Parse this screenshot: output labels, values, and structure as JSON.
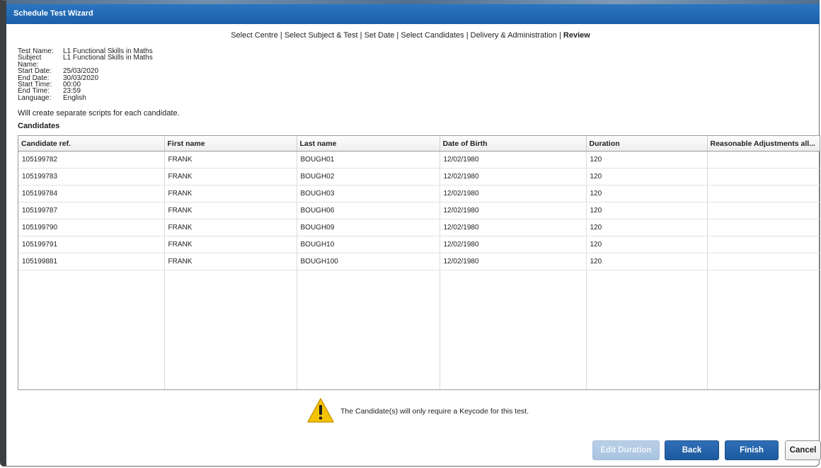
{
  "window": {
    "title": "Schedule Test Wizard"
  },
  "steps": [
    {
      "label": "Select Centre"
    },
    {
      "label": "Select Subject & Test"
    },
    {
      "label": "Set Date"
    },
    {
      "label": "Select Candidates"
    },
    {
      "label": "Delivery & Administration"
    },
    {
      "label": "Review"
    }
  ],
  "step_separator": " | ",
  "test_info": [
    {
      "key": "Test Name:",
      "value": "L1 Functional Skills in Maths"
    },
    {
      "key": "Subject Name:",
      "value": "L1 Functional Skills in Maths"
    },
    {
      "key": "Start Date:",
      "value": "25/03/2020"
    },
    {
      "key": "End Date:",
      "value": "30/03/2020"
    },
    {
      "key": "Start Time:",
      "value": "00:00"
    },
    {
      "key": "End Time:",
      "value": "23:59"
    },
    {
      "key": "Language:",
      "value": "English"
    }
  ],
  "note": "Will create separate scripts for each candidate.",
  "section_title": "Candidates",
  "table": {
    "columns": [
      "Candidate ref.",
      "First name",
      "Last name",
      "Date of Birth",
      "Duration",
      "Reasonable Adjustments all..."
    ],
    "rows": [
      [
        "105199782",
        "FRANK",
        "BOUGH01",
        "12/02/1980",
        "120",
        ""
      ],
      [
        "105199783",
        "FRANK",
        "BOUGH02",
        "12/02/1980",
        "120",
        ""
      ],
      [
        "105199784",
        "FRANK",
        "BOUGH03",
        "12/02/1980",
        "120",
        ""
      ],
      [
        "105199787",
        "FRANK",
        "BOUGH06",
        "12/02/1980",
        "120",
        ""
      ],
      [
        "105199790",
        "FRANK",
        "BOUGH09",
        "12/02/1980",
        "120",
        ""
      ],
      [
        "105199791",
        "FRANK",
        "BOUGH10",
        "12/02/1980",
        "120",
        ""
      ],
      [
        "105199881",
        "FRANK",
        "BOUGH100",
        "12/02/1980",
        "120",
        ""
      ]
    ]
  },
  "warning": {
    "icon": "warning-triangle-icon",
    "text": "The Candidate(s) will only require a Keycode for this test."
  },
  "buttons": {
    "edit_duration": "Edit Duration",
    "back": "Back",
    "finish": "Finish",
    "cancel": "Cancel"
  },
  "colors": {
    "titlebar": "#1b5fa8",
    "primary_button": "#1d5a9e",
    "disabled_button": "#a9c3e0",
    "warning_yellow": "#f5c400"
  }
}
